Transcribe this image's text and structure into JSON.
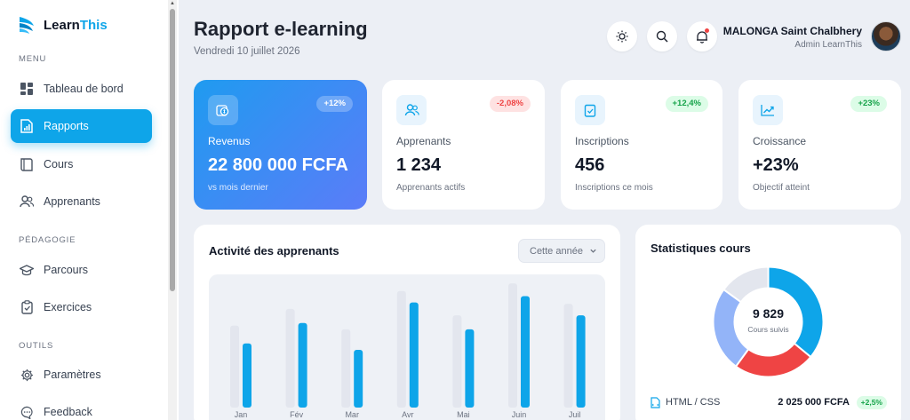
{
  "brand": {
    "name_part1": "Learn",
    "name_part2": "This",
    "accent": "#0ea5e9"
  },
  "sidebar": {
    "sections": [
      {
        "label": "MENU"
      },
      {
        "label": "PÉDAGOGIE"
      },
      {
        "label": "OUTILS"
      }
    ],
    "items": [
      {
        "label": "Tableau de bord",
        "icon": "dashboard-icon",
        "active": false
      },
      {
        "label": "Rapports",
        "icon": "report-icon",
        "active": true
      },
      {
        "label": "Cours",
        "icon": "book-icon",
        "active": false
      },
      {
        "label": "Apprenants",
        "icon": "users-icon",
        "active": false
      },
      {
        "label": "Parcours",
        "icon": "graduation-cap-icon",
        "active": false
      },
      {
        "label": "Exercices",
        "icon": "clipboard-icon",
        "active": false
      },
      {
        "label": "Paramètres",
        "icon": "gear-icon",
        "active": false
      },
      {
        "label": "Feedback",
        "icon": "chat-icon",
        "active": false
      }
    ]
  },
  "header": {
    "title": "Rapport e-learning",
    "date": "Vendredi 10 juillet 2026",
    "user": {
      "name": "MALONGA Saint Chalbhery",
      "role": "Admin LearnThis"
    }
  },
  "stats": [
    {
      "label": "Revenus",
      "value": "22 800 000 FCFA",
      "sub": "vs mois dernier",
      "badge": "+12%",
      "trend": "up",
      "icon": "money-icon"
    },
    {
      "label": "Apprenants",
      "value": "1 234",
      "sub": "Apprenants actifs",
      "badge": "-2,08%",
      "trend": "down",
      "icon": "users-icon"
    },
    {
      "label": "Inscriptions",
      "value": "456",
      "sub": "Inscriptions ce mois",
      "badge": "+12,4%",
      "trend": "up",
      "icon": "checklist-icon"
    },
    {
      "label": "Croissance",
      "value": "+23%",
      "sub": "Objectif atteint",
      "badge": "+23%",
      "trend": "up",
      "icon": "trend-icon"
    }
  ],
  "activity": {
    "title": "Activité des apprenants",
    "period_select": "Cette année"
  },
  "chart_data": {
    "type": "bar",
    "categories": [
      "Jan",
      "Fév",
      "Mar",
      "Avr",
      "Mai",
      "Juin",
      "Juil"
    ],
    "series": [
      {
        "values": [
          60,
          73,
          57,
          87,
          68,
          93,
          77
        ],
        "color": "#e3e6ee"
      },
      {
        "values": [
          46,
          62,
          41,
          78,
          57,
          83,
          68
        ],
        "color": "#0ea5e9"
      }
    ],
    "ylim": [
      0,
      100
    ],
    "grid": false,
    "legend": "none"
  },
  "course_stats": {
    "title": "Statistiques cours",
    "total": "9 829",
    "total_label": "Cours suivis",
    "donut": {
      "type": "pie",
      "slices": [
        {
          "value": 36,
          "color": "#0ea5e9"
        },
        {
          "value": 24,
          "color": "#ef4444"
        },
        {
          "value": 25,
          "color": "#93b4f8"
        },
        {
          "value": 15,
          "color": "#e3e6ee"
        }
      ]
    },
    "rows": [
      {
        "name": "HTML / CSS",
        "amount": "2 025 000 FCFA",
        "badge": "+2,5%"
      }
    ]
  }
}
